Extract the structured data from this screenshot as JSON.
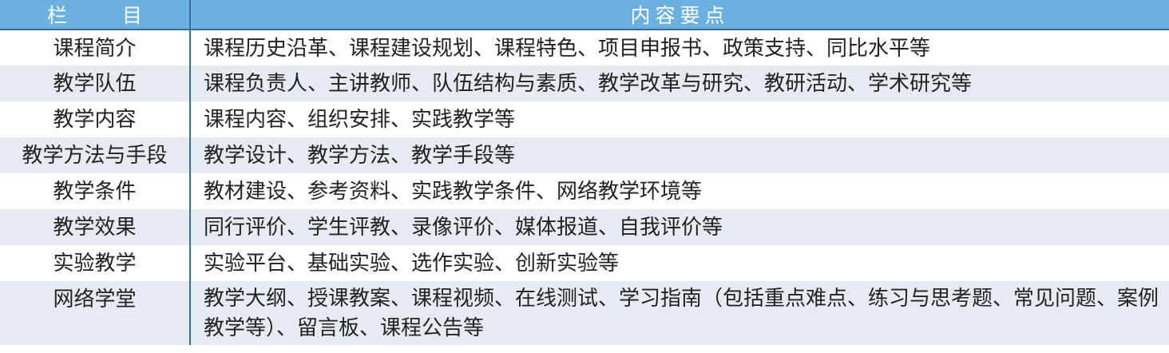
{
  "table": {
    "header": [
      "栏　目",
      "内容要点"
    ],
    "rows": [
      {
        "item": "课程简介",
        "content": "课程历史沿革、课程建设规划、课程特色、项目申报书、政策支持、同比水平等"
      },
      {
        "item": "教学队伍",
        "content": "课程负责人、主讲教师、队伍结构与素质、教学改革与研究、教研活动、学术研究等"
      },
      {
        "item": "教学内容",
        "content": "课程内容、组织安排、实践教学等"
      },
      {
        "item": "教学方法与手段",
        "content": "教学设计、教学方法、教学手段等"
      },
      {
        "item": "教学条件",
        "content": "教材建设、参考资料、实践教学条件、网络教学环境等"
      },
      {
        "item": "教学效果",
        "content": "同行评价、学生评教、录像评价、媒体报道、自我评价等"
      },
      {
        "item": "实验教学",
        "content": "实验平台、基础实验、选作实验、创新实验等"
      },
      {
        "item": "网络学堂",
        "content": "教学大纲、授课教案、课程视频、在线测试、学习指南（包括重点难点、练习与思考题、常见问题、案例教学等）、留言板、课程公告等"
      }
    ]
  },
  "colors": {
    "header_bg": "#6ab0e0",
    "header_text": "#ffffff",
    "rule": "#3a6f98",
    "shade": "#e6ebf1"
  }
}
